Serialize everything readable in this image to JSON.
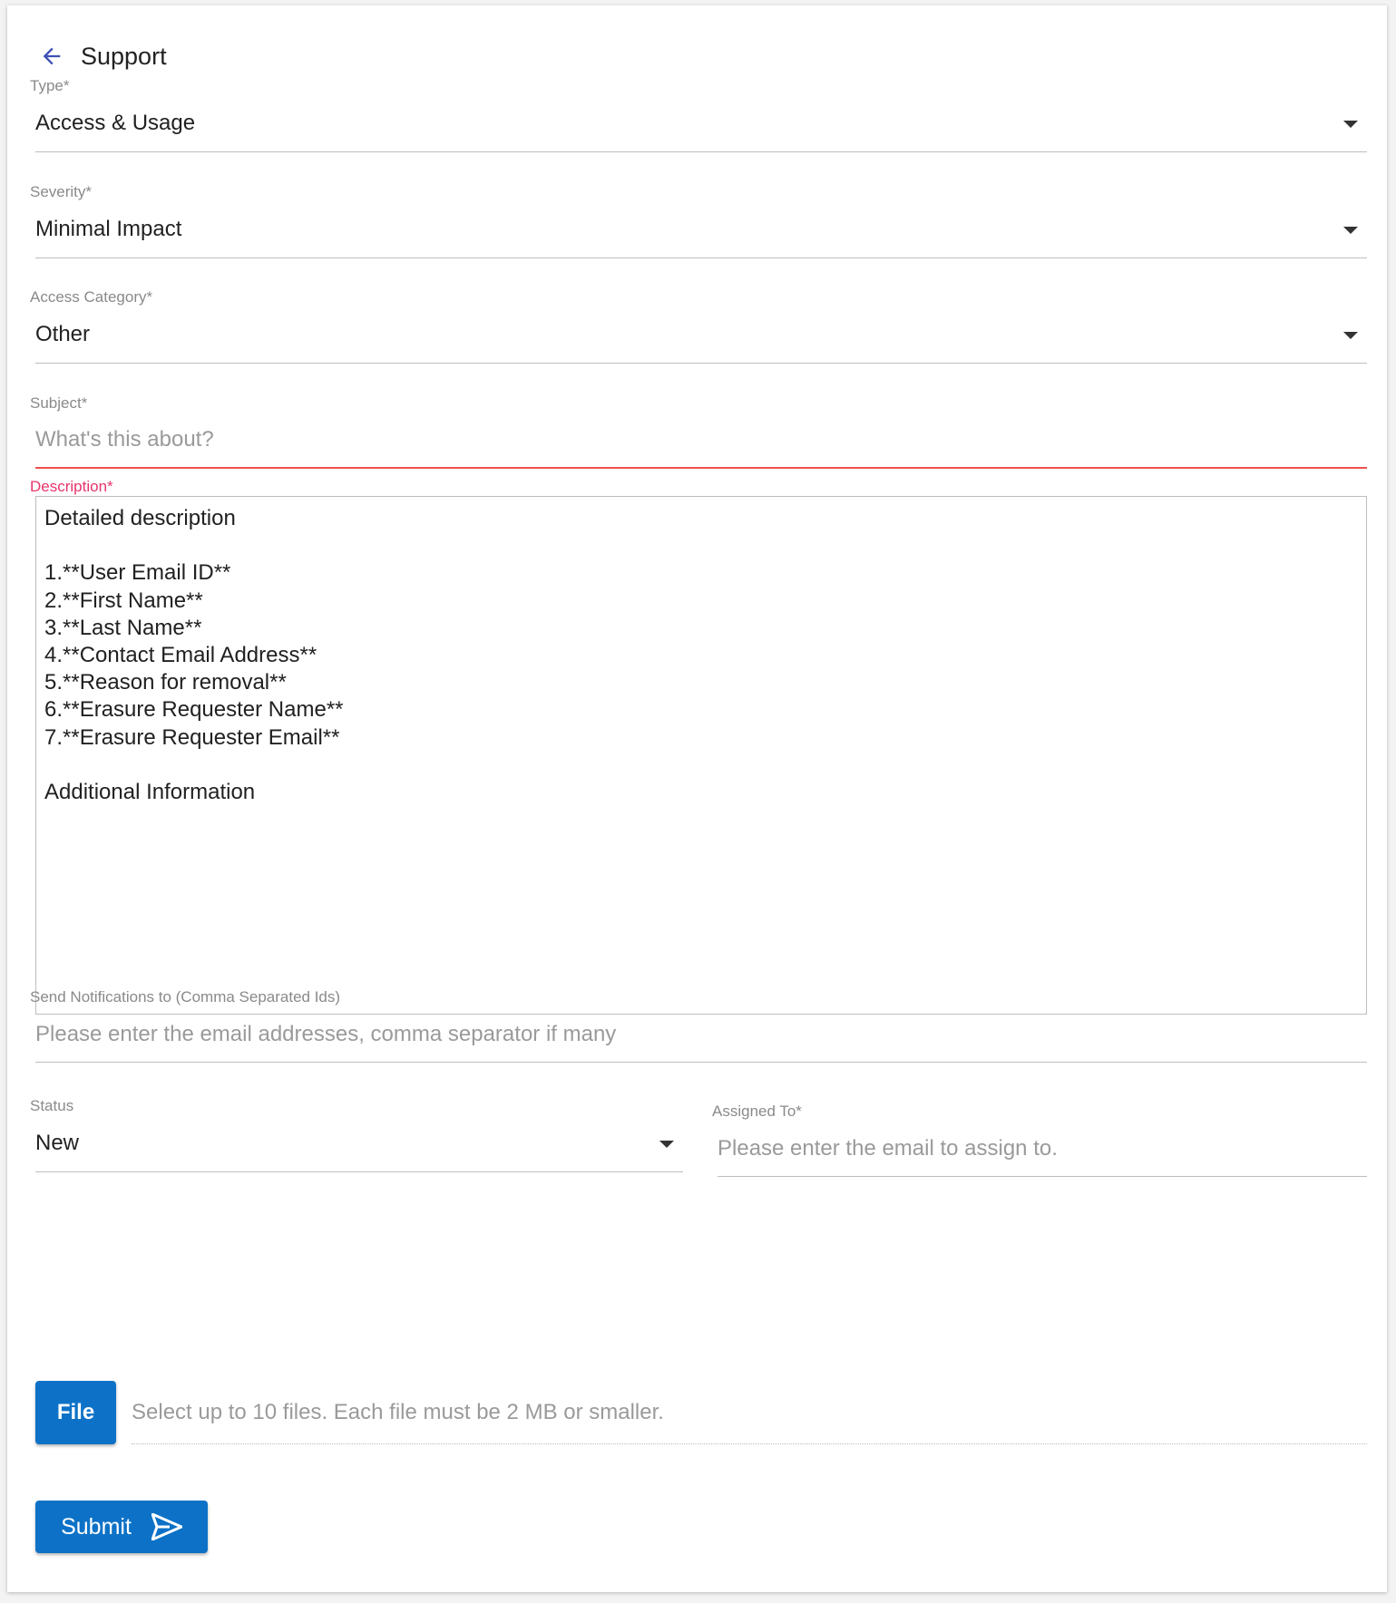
{
  "header": {
    "title": "Support",
    "back_icon": "arrow-left-icon"
  },
  "type": {
    "label": "Type*",
    "value": "Access & Usage"
  },
  "severity": {
    "label": "Severity*",
    "value": "Minimal Impact"
  },
  "access_category": {
    "label": "Access Category*",
    "value": "Other"
  },
  "subject": {
    "label": "Subject*",
    "placeholder": "What's this about?"
  },
  "description": {
    "label": "Description*",
    "value": "Detailed description\n\n1.**User Email ID**\n2.**First Name**\n3.**Last Name**\n4.**Contact Email Address**\n5.**Reason for removal**\n6.**Erasure Requester Name**\n7.**Erasure Requester Email**\n\nAdditional Information"
  },
  "notifications": {
    "label": "Send Notifications to (Comma Separated Ids)",
    "placeholder": "Please enter the email addresses, comma separator if many"
  },
  "status": {
    "label": "Status",
    "value": "New"
  },
  "assigned_to": {
    "label": "Assigned To*",
    "placeholder": "Please enter the email to assign to."
  },
  "file": {
    "button_label": "File",
    "hint": "Select up to 10 files. Each file must be 2 MB or smaller."
  },
  "submit": {
    "label": "Submit",
    "icon": "send-icon"
  },
  "colors": {
    "primary": "#0d72c7",
    "error": "#e8356b",
    "error_underline": "#f0504f",
    "back_arrow": "#3f51b5"
  }
}
